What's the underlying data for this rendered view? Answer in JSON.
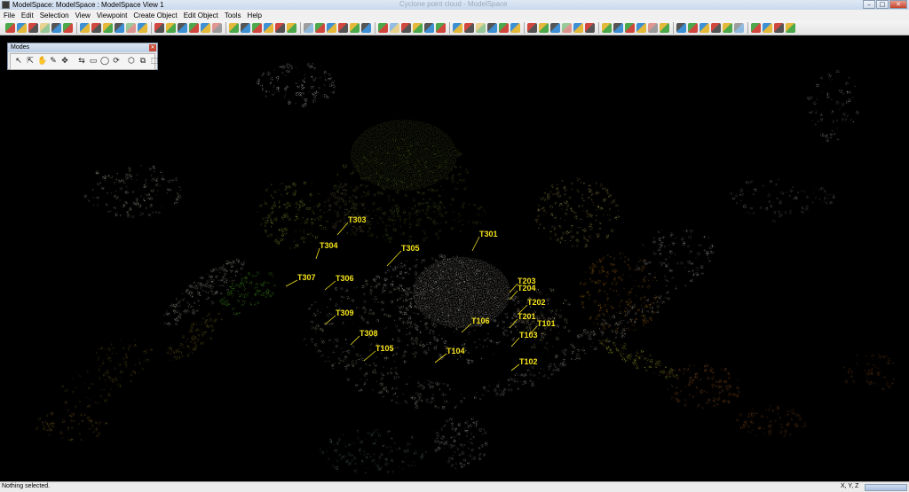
{
  "window": {
    "title": "ModelSpace: ModelSpace : ModelSpace View 1",
    "doc_title": "Cyclone point cloud - ModelSpace",
    "controls": {
      "minimize": "–",
      "maximize": "□",
      "close": "✕"
    }
  },
  "menu": {
    "items": [
      "File",
      "Edit",
      "Selection",
      "View",
      "Viewpoint",
      "Create Object",
      "Edit Object",
      "Tools",
      "Help"
    ]
  },
  "toolbar": {
    "icons": [
      "pick-icon",
      "multi-pick-icon",
      "seed-icon",
      "layer-icon",
      "color-icon",
      "erase-icon",
      "fence-icon",
      "view-icon",
      "zoom-icon",
      "measure-icon",
      "undo-icon",
      "redo-icon",
      "cut-icon",
      "copy-icon",
      "paste-icon",
      "delete-icon",
      "snap-icon",
      "zoom-in-icon",
      "zoom-out-icon",
      "fit-icon",
      "orbit-icon",
      "pan-icon",
      "render-icon",
      "object-icon"
    ],
    "accent_colors": [
      "#2f9c2f",
      "#1f7fd0",
      "#cc2a1f",
      "#e3b01a",
      "#3a3a3a"
    ]
  },
  "modes": {
    "title": "Modes",
    "tools": [
      "↖",
      "⇱",
      "✋",
      "✎",
      "✥",
      "⇆",
      "▭",
      "◯",
      "⟳",
      "⬡",
      "⧉",
      "⬚"
    ]
  },
  "viewport": {
    "background": "#000000",
    "tag_color": "#f4e21a",
    "tags": [
      "T303",
      "T304",
      "T305",
      "T301",
      "T307",
      "T306",
      "T309",
      "T308",
      "T105",
      "T104",
      "T106",
      "T203",
      "T204",
      "T202",
      "T201",
      "T101",
      "T103",
      "T102"
    ]
  },
  "status": {
    "message": "Nothing selected.",
    "coords_label": "X, Y, Z"
  }
}
